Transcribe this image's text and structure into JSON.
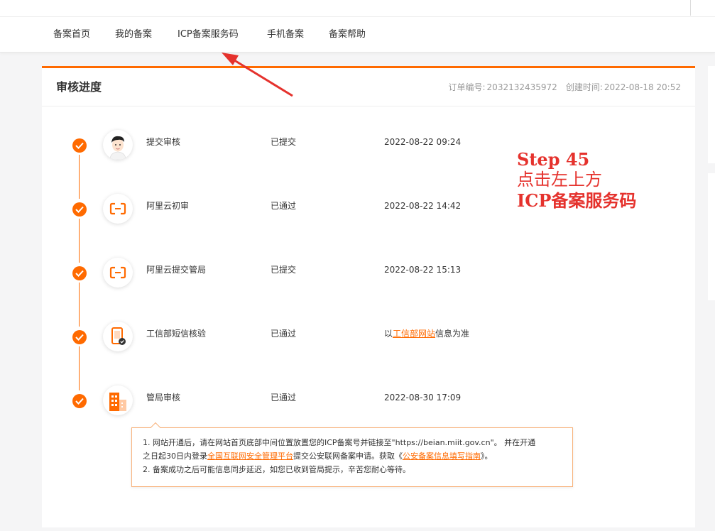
{
  "nav": {
    "items": [
      "备案首页",
      "我的备案",
      "ICP备案服务码",
      "手机备案",
      "备案帮助"
    ]
  },
  "progress": {
    "title": "审核进度",
    "order_label": "订单编号:",
    "order_number": "2032132435972",
    "created_label": "创建时间:",
    "created_time": "2022-08-18 20:52"
  },
  "steps": [
    {
      "name": "提交审核",
      "status": "已提交",
      "time": "2022-08-22 09:24",
      "icon": "user-avatar-icon"
    },
    {
      "name": "阿里云初审",
      "status": "已通过",
      "time": "2022-08-22 14:42",
      "icon": "aliyun-logo-icon"
    },
    {
      "name": "阿里云提交管局",
      "status": "已提交",
      "time": "2022-08-22 15:13",
      "icon": "aliyun-logo-icon"
    },
    {
      "name": "工信部短信核验",
      "status": "已通过",
      "time_prefix": "以",
      "time_link": "工信部网站",
      "time_suffix": "信息为准",
      "icon": "phone-check-icon"
    },
    {
      "name": "管局审核",
      "status": "已通过",
      "time": "2022-08-30 17:09",
      "icon": "building-icon"
    }
  ],
  "notice": {
    "line1_a": "1. 网站开通后，请在网站首页底部中间位置放置您的ICP备案号并链接至\"https://beian.miit.gov.cn\"。 并在开通",
    "line2_a": "之日起30日内登录",
    "line2_link1": "全国互联网安全管理平台",
    "line2_b": "提交公安联网备案申请。获取《",
    "line2_link2": "公安备案信息填写指南",
    "line2_c": "》。",
    "line3": "2. 备案成功之后可能信息同步延迟，如您已收到管局提示，辛苦您耐心等待。"
  },
  "annotation": {
    "line1": "Step 45",
    "line2": "点击左上方",
    "line3": "ICP备案服务码"
  },
  "colors": {
    "accent": "#ff6a00",
    "annotation": "#e5322d"
  }
}
